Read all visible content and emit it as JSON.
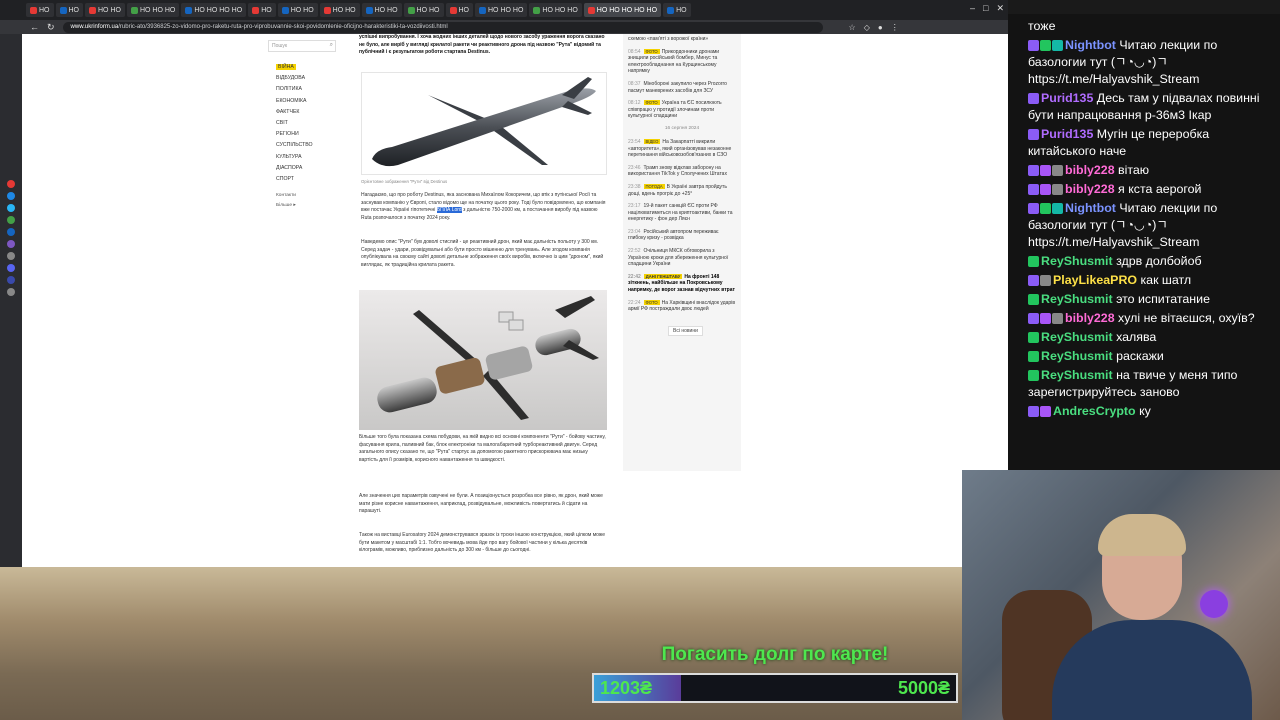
{
  "browser": {
    "tabs": [
      {
        "label": "НО",
        "color": "#e53935"
      },
      {
        "label": "НО",
        "color": "#1565c0"
      },
      {
        "label": "НО НО",
        "color": "#e53935"
      },
      {
        "label": "НО НО НО",
        "color": "#43a047"
      },
      {
        "label": "НО НО НО НО",
        "color": "#1565c0"
      },
      {
        "label": "НО",
        "color": "#e53935"
      },
      {
        "label": "НО НО",
        "color": "#1565c0"
      },
      {
        "label": "НО НО",
        "color": "#e53935"
      },
      {
        "label": "НО НО",
        "color": "#1565c0"
      },
      {
        "label": "НО НО",
        "color": "#43a047"
      },
      {
        "label": "НО",
        "color": "#e53935"
      },
      {
        "label": "НО НО НО",
        "color": "#1565c0"
      },
      {
        "label": "НО НО НО",
        "color": "#43a047"
      },
      {
        "label": "НО НО НО НО НО",
        "color": "#e53935"
      },
      {
        "label": "НО",
        "color": "#1565c0"
      }
    ],
    "url_domain": "www.ukrinform.ua",
    "url_path": "/rubric-ato/3936825-zo-vidomo-pro-raketu-ruta-pro-viprobuvannie-skoi-povidomlenie-oficijno-harakteristiki-ta-vozdiivosti.html"
  },
  "site": {
    "search_placeholder": "Пошук",
    "menu": [
      "ВІЙНА",
      "ВІДБУДОВА",
      "ПОЛІТИКА",
      "ЕКОНОМІКА",
      "ФАКТЧЕК",
      "СВІТ",
      "РЕГІОНИ",
      "СУСПІЛЬСТВО",
      "КУЛЬТУРА",
      "ДІАСПОРА",
      "СПОРТ"
    ],
    "menu_sub": [
      "Контакти",
      "Більше ▸"
    ]
  },
  "article": {
    "intro": "успішні випробування. І хоча жодних інших деталей щодо нового засобу ураження ворога сказано не було, але виріб у вигляді крилатої ракети чи реактивного дрона під назвою \"Рута\" відомий та публічний і є результатом роботи стартапа Destinus.",
    "caption": "Орієнтовне зображення \"Рути\" від Destinus",
    "p1_a": "Нагадаємо, що про роботу Destinus, яка заснована Михаїлом Кокоричем, що втік з путінської Росії та заснував компанію у Європі, стало відомо ще на початку цього року. Тоді було повідомлено, що компанія вже постачає Україні гіпотетичні",
    "p1_hl": "БПЛА Lord",
    "p1_b": "з дальністю 750-2000 км, а постачання виробу під назвою Ruta розпочалося з початку 2024 року.",
    "p2": "Наведемо опис \"Рути\" був доволі стислий - це реактивний дрон, який має дальність польоту у 300 км. Серед задач - удари, розвідувальні або бути просто мішенню для тренувань. Але згодом компанія опублікувала на своєму сайті доволі детальне зображення своїх виробів, включно із цим \"дроном\", який виглядає, як традиційна крилата ракета.",
    "p3": "Більше того була показана схема побудови, на якій видно всі основні компоненти \"Рути\" - бойову частину, фасування крила, паливний бак, блок електроніки та малогабаритний турбореактивний двигун. Серед загального опису сказано те, що \"Рута\" стартує за допомогою ракетного прискорювача має низьку вартість для її розмірів, корисного навантаження та швидкості.",
    "p4": "Але значення цих параметрів озвучені не були. А позиціонується розробка все рівно, як дрон, який може мати різне корисне навантаження, наприклад, розвідувальне, можливість повертатись й сідати на парашуті.",
    "p5": "Також на виставці Eurosatory 2024 демонструвався зразок із трохи іншою конструкцією, який цілком може бути макетом у масштабі 1:1. Тобто вочевидь мова йде про вагу бойової частини у кілька десятків кілограмів, можливо, приблизно дальність до 300 км - більше до сьогодні."
  },
  "feed": {
    "top": "схемою «пам'яті з ворожої країни»",
    "items": [
      {
        "time": "08:54",
        "tag": "ФОТО",
        "text": "Прикордонники дронами знищили російський бомбер, Минус та електрообладнання на Курщинському напрямку",
        "bold": false
      },
      {
        "time": "08:37",
        "tag": "",
        "text": "Мінобороні закупило через Prozorro пасмут маневрених засобів для ЗСУ",
        "bold": false
      },
      {
        "time": "08:12",
        "tag": "ФОТО",
        "text": "Україна та ЄС посилюють співпрацю у протидії злочинам проти культурної спадщини",
        "bold": false
      }
    ],
    "date": "16 серпня 2024",
    "items2": [
      {
        "time": "23:54",
        "tag": "ВІДЕО",
        "text": "На Закарпатті викрили «авторитета», який організовував незаконне перетинання військовозобов'язаних в СЗО",
        "bold": false
      },
      {
        "time": "23:46",
        "tag": "",
        "text": "Трамп знову відклав заборону на використання TikTok у Сполучених Штатах",
        "bold": false
      },
      {
        "time": "23:38",
        "tag": "ПОГОДА",
        "text": "В Україні завтра пройдуть дощі, вдень прогріє до +25°",
        "bold": false
      },
      {
        "time": "23:17",
        "tag": "",
        "text": "19-й пакет санкцій ЄС проти РФ націлюватиметься на криптоактиви, банки та енергетику - фон дер Ляєн",
        "bold": false
      },
      {
        "time": "23:04",
        "tag": "",
        "text": "Російський автопром переживає глибоку кризу - розвідка",
        "bold": false
      },
      {
        "time": "22:52",
        "tag": "",
        "text": "Очільниця МКСК обговорила з Україною кроки для збереження культурної спадщини України",
        "bold": false
      },
      {
        "time": "22:42",
        "tag": "ДАНІ ГЕНШТАБУ",
        "text": "На фронті 148 зіткнень, найбільше на Покровському напрямку, де ворог зазнав відчутних втрат",
        "bold": true
      },
      {
        "time": "22:24",
        "tag": "ФОТО",
        "text": "На Харківщині внаслідок ударів армії РФ постраждали двоє людей",
        "bold": false
      }
    ],
    "more": "Всі новини"
  },
  "chat": {
    "top_fragment": "тоже",
    "messages": [
      {
        "user": "Nightbot",
        "color": "#7b93ff",
        "text": "Читаю лекции по базологии тут (ㄱ◔◡◔)ㄱ https://t.me/Halyavshik_Stream",
        "badges": [
          "#8b5cf6",
          "#22c55e",
          "#14b8a6"
        ]
      },
      {
        "user": "Purid135",
        "color": "#b06cff",
        "text": "Десь там у підвалах повинні бути напрацювання р-36м3 Ікар",
        "badges": [
          "#8b5cf6"
        ]
      },
      {
        "user": "Purid135",
        "color": "#b06cff",
        "text": "Мугін це переробка китайського наче",
        "badges": [
          "#8b5cf6"
        ]
      },
      {
        "user": "bibly228",
        "color": "#ff6bd6",
        "text": "вітаю",
        "badges": [
          "#8b5cf6",
          "#a855f7",
          "#888888"
        ]
      },
      {
        "user": "bibly228",
        "color": "#ff6bd6",
        "text": "я кста аерогой",
        "badges": [
          "#8b5cf6",
          "#a855f7",
          "#888888"
        ]
      },
      {
        "user": "Nightbot",
        "color": "#7b93ff",
        "text": "Читаю лекции по базологии тут (ㄱ◔◡◔)ㄱ https://t.me/Halyavshik_Stream",
        "badges": [
          "#8b5cf6",
          "#22c55e",
          "#14b8a6"
        ]
      },
      {
        "user": "ReyShusmit",
        "color": "#4ade80",
        "text": "здрв долбойоб",
        "badges": [
          "#22c55e"
        ]
      },
      {
        "user": "PlayLikeaPRO",
        "color": "#fde047",
        "text": "как шатл",
        "badges": [
          "#8b5cf6",
          "#888888"
        ]
      },
      {
        "user": "ReyShusmit",
        "color": "#4ade80",
        "text": "это испитатание",
        "badges": [
          "#22c55e"
        ]
      },
      {
        "user": "bibly228",
        "color": "#ff6bd6",
        "text": "хулі не вітаєшся, охуїв?",
        "badges": [
          "#8b5cf6",
          "#a855f7",
          "#888888"
        ]
      },
      {
        "user": "ReyShusmit",
        "color": "#4ade80",
        "text": "халява",
        "badges": [
          "#22c55e"
        ]
      },
      {
        "user": "ReyShusmit",
        "color": "#4ade80",
        "text": "раскажи",
        "badges": [
          "#22c55e"
        ]
      },
      {
        "user": "ReyShusmit",
        "color": "#4ade80",
        "text": "на твиче у меня типо зарегистрируйтесь заново",
        "badges": [
          "#22c55e"
        ]
      },
      {
        "user": "AndresCrypto",
        "color": "#4ade80",
        "text": "ку",
        "badges": [
          "#8b5cf6",
          "#a855f7"
        ]
      }
    ]
  },
  "donation": {
    "title": "Погасить долг по карте!",
    "current": "1203₴",
    "goal": "5000₴",
    "progress_fraction": 0.24
  }
}
